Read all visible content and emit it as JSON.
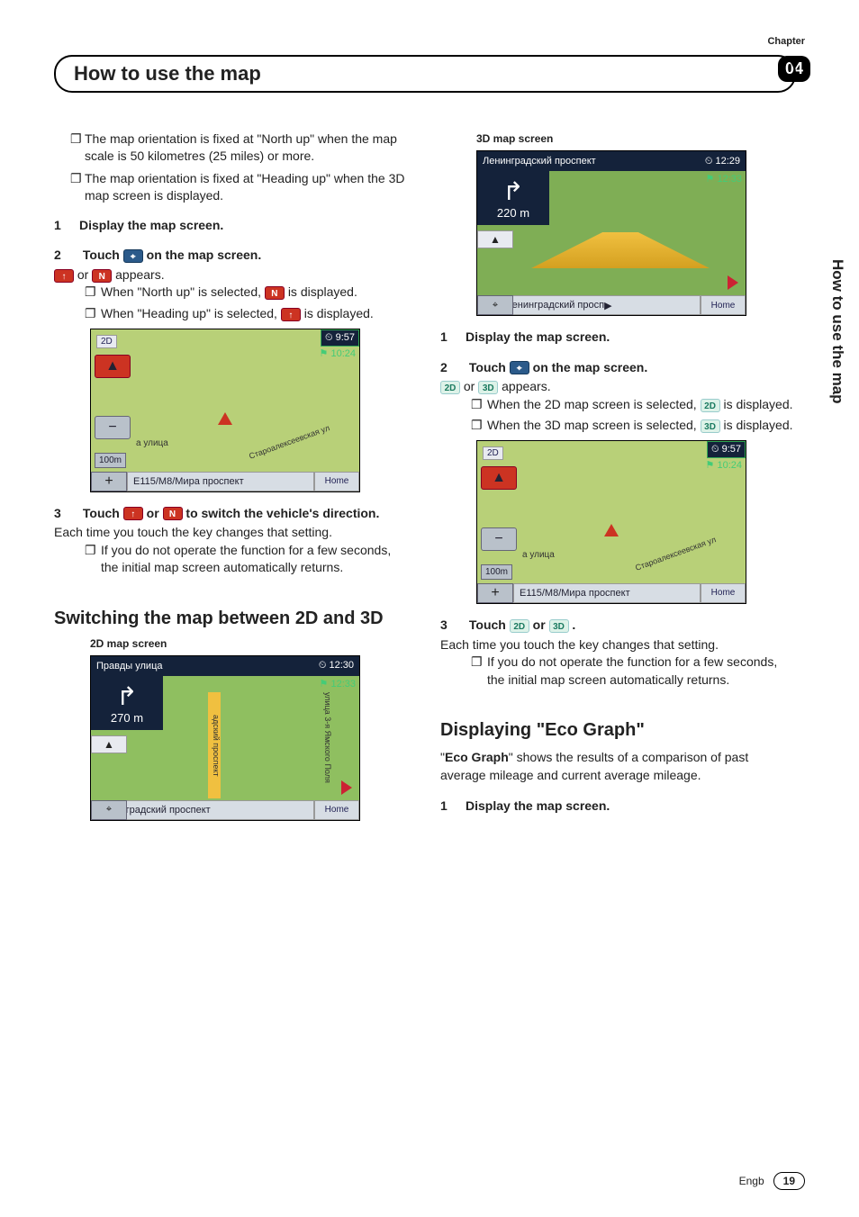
{
  "header": {
    "chapter_label": "Chapter",
    "chapter_num": "04",
    "title": "How to use the map",
    "side_tab": "How to use the map"
  },
  "left": {
    "bullets": [
      "The map orientation is fixed at \"North up\" when the map scale is 50 kilometres (25 miles) or more.",
      "The map orientation is fixed at \"Heading up\" when the 3D map screen is displayed."
    ],
    "step1": "Display the map screen.",
    "step2_pre": "Touch",
    "step2_post": "on the map screen.",
    "appears_or": "or",
    "appears_tail": "appears.",
    "sb1_pre": "When \"North up\" is selected,",
    "sb1_post": "is displayed.",
    "sb2_pre": "When \"Heading up\" is selected,",
    "sb2_post": "is displayed.",
    "map1": {
      "corner": "2D",
      "time1": "9:57",
      "time2": "10:24",
      "scale": "100m",
      "street": "а улица",
      "diag": "Староалексеевская ул",
      "road": "E115/М8/Мира проспект",
      "home": "Home"
    },
    "step3_pre": "Touch",
    "step3_mid": "or",
    "step3_post": "to switch the vehicle's direction.",
    "step3_para": "Each time you touch the key changes that setting.",
    "step3_sub": "If you do not operate the function for a few seconds, the initial map screen automatically returns.",
    "subhead": "Switching the map between 2D and 3D",
    "cap2d": "2D map screen",
    "map2": {
      "top": "Правды улица",
      "time1": "12:30",
      "time2": "12:33",
      "dist": "270 m",
      "vroad1": "адский проспект",
      "vroad2": "улица 3-я Ямского Поля",
      "road": "Ленинградский проспект",
      "home": "Home"
    }
  },
  "right": {
    "cap3d": "3D map screen",
    "map3": {
      "top": "Ленинградский проспект",
      "time1": "12:29",
      "time2": "12:33",
      "dist": "220 m",
      "road": "М10/Ленинградский просп",
      "home": "Home"
    },
    "step1": "Display the map screen.",
    "step2_pre": "Touch",
    "step2_post": "on the map screen.",
    "appears_or": "or",
    "appears_tail": "appears.",
    "sb1_pre": "When the 2D map screen is selected,",
    "sb1_post": "is displayed.",
    "sb2_pre": "When the 3D map screen is selected,",
    "sb2_post": "is displayed.",
    "map4": {
      "corner": "2D",
      "time1": "9:57",
      "time2": "10:24",
      "scale": "100m",
      "street": "а улица",
      "diag": "Староалексеевская ул",
      "road": "E115/М8/Мира проспект",
      "home": "Home"
    },
    "step3_pre": "Touch",
    "step3_mid": "or",
    "step3_post": ".",
    "step3_para": "Each time you touch the key changes that setting.",
    "step3_sub": "If you do not operate the function for a few seconds, the initial map screen automatically returns.",
    "subhead_pre": "Displaying \"",
    "subhead_em": "Eco Graph",
    "subhead_post": "\"",
    "eco_para_pre": "\"",
    "eco_para_bold": "Eco Graph",
    "eco_para_post": "\" shows the results of a comparison of past average mileage and current average mileage.",
    "eco_step1": "Display the map screen."
  },
  "icons": {
    "compass": "⌖",
    "heading_up": "↑",
    "north_up": "N",
    "twoD": "2D",
    "threeD": "3D"
  },
  "footer": {
    "lang": "Engb",
    "page": "19"
  }
}
